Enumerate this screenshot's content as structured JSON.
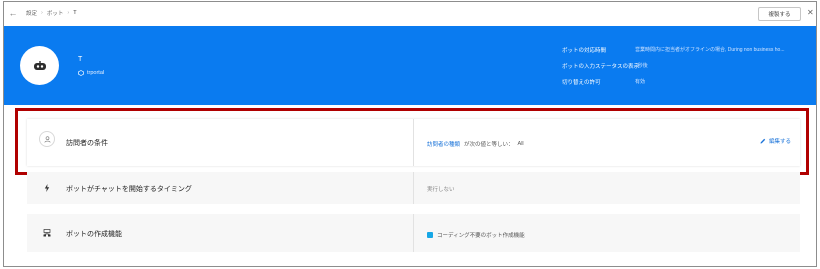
{
  "breadcrumb": {
    "items": [
      "設定",
      "ボット",
      "T"
    ]
  },
  "toolbar": {
    "copy_label": "複製する",
    "close_glyph": "✕",
    "back_glyph": "←"
  },
  "bot": {
    "name": "T",
    "portal": "trportal"
  },
  "info": [
    {
      "label": "ボットの対応時間",
      "value": "営業時間内に担当者がオフラインの場合, During non business ho..."
    },
    {
      "label": "ボットの入力ステータスの表示",
      "value": "2秒後"
    },
    {
      "label": "切り替えの許可",
      "value": "有効"
    }
  ],
  "sections": {
    "visitor": {
      "title": "訪問者の条件",
      "condition_field": "訪問者の種類",
      "condition_op": "が次の値と等しい：",
      "condition_value": "All",
      "edit_label": "編集する"
    },
    "timing": {
      "title": "ボットがチャットを開始するタイミング",
      "value": "実行しない"
    },
    "builder": {
      "title": "ボットの作成機能",
      "value": "コーディング不要のボット作成機能"
    }
  },
  "icons": {
    "back": "arrow-left-icon",
    "close": "close-icon",
    "avatar": "bot-icon",
    "portal": "portal-icon",
    "visitor": "person-icon",
    "timing": "lightning-icon",
    "builder": "builder-icon",
    "edit": "pencil-icon"
  },
  "colors": {
    "hero": "#0a7bf0",
    "highlight": "#b00000",
    "link": "#1a73d9"
  }
}
